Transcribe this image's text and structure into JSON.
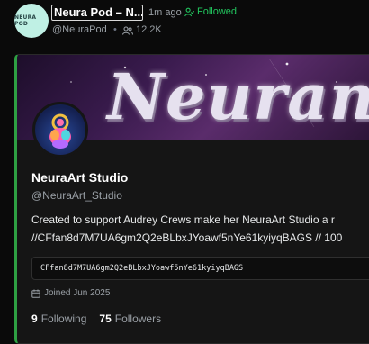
{
  "post": {
    "avatar_text": "NEURA POD",
    "display_name": "Neura Pod – N...",
    "time_ago": "1m ago",
    "follow_status": "Followed",
    "handle": "@NeuraPod",
    "separator": "•",
    "follower_count": "12.2K"
  },
  "card": {
    "banner_text": "Neuran",
    "name": "NeuraArt Studio",
    "handle": "@NeuraArt_Studio",
    "bio_line1": "Created to support Audrey Crews make her NeuraArt Studio a r",
    "bio_line2": "//CFfan8d7M7UA6gm2Q2eBLbxJYoawf5nYe61kyiyqBAGS // 100",
    "contract_address": "CFfan8d7M7UA6gm2Q2eBLbxJYoawf5nYe61kyiyqBAGS",
    "joined": "Joined Jun 2025",
    "following_count": "9",
    "following_label": "Following",
    "followers_count": "75",
    "followers_label": "Followers"
  },
  "colors": {
    "accent_green": "#22c55e",
    "card_border_accent": "#2ea043",
    "background": "#0a0a0a"
  },
  "icons": {
    "follow_status": "person-check-icon",
    "followers": "people-icon",
    "joined": "calendar-icon"
  }
}
